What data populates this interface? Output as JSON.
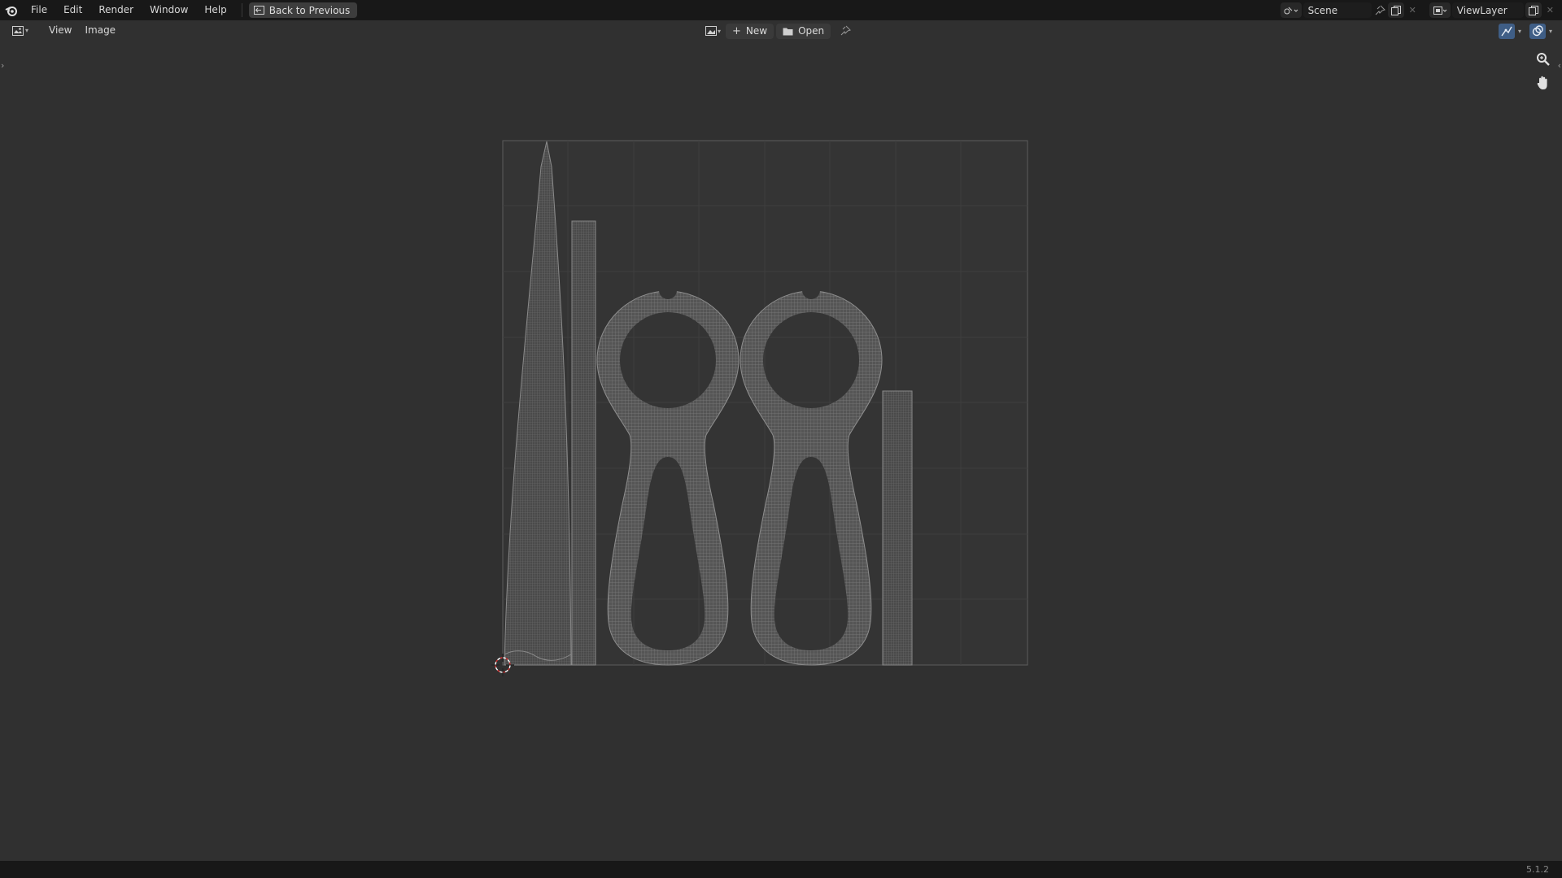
{
  "topbar": {
    "menus": [
      "File",
      "Edit",
      "Render",
      "Window",
      "Help"
    ],
    "back_button": "Back to Previous",
    "scene_name": "Scene",
    "view_layer_name": "ViewLayer"
  },
  "image_editor_header": {
    "menus": [
      "View",
      "Image"
    ],
    "new_label": "New",
    "open_label": "Open"
  },
  "status_bar": {
    "version": "5.1.2"
  },
  "icons": [
    "blender-logo-icon",
    "back-icon",
    "scene-icon",
    "pin-icon",
    "copy-icon",
    "close-icon",
    "view-layer-icon",
    "editor-type-icon",
    "image-browse-icon",
    "plus-icon",
    "folder-icon",
    "uv-sync-icon",
    "overlay-icon",
    "zoom-icon",
    "hand-pan-icon",
    "cursor-icon"
  ],
  "colors": {
    "topbar": "#181818",
    "background": "#303030",
    "uv_wire": "#8c8c8c",
    "grid": "#3c3c3c"
  }
}
